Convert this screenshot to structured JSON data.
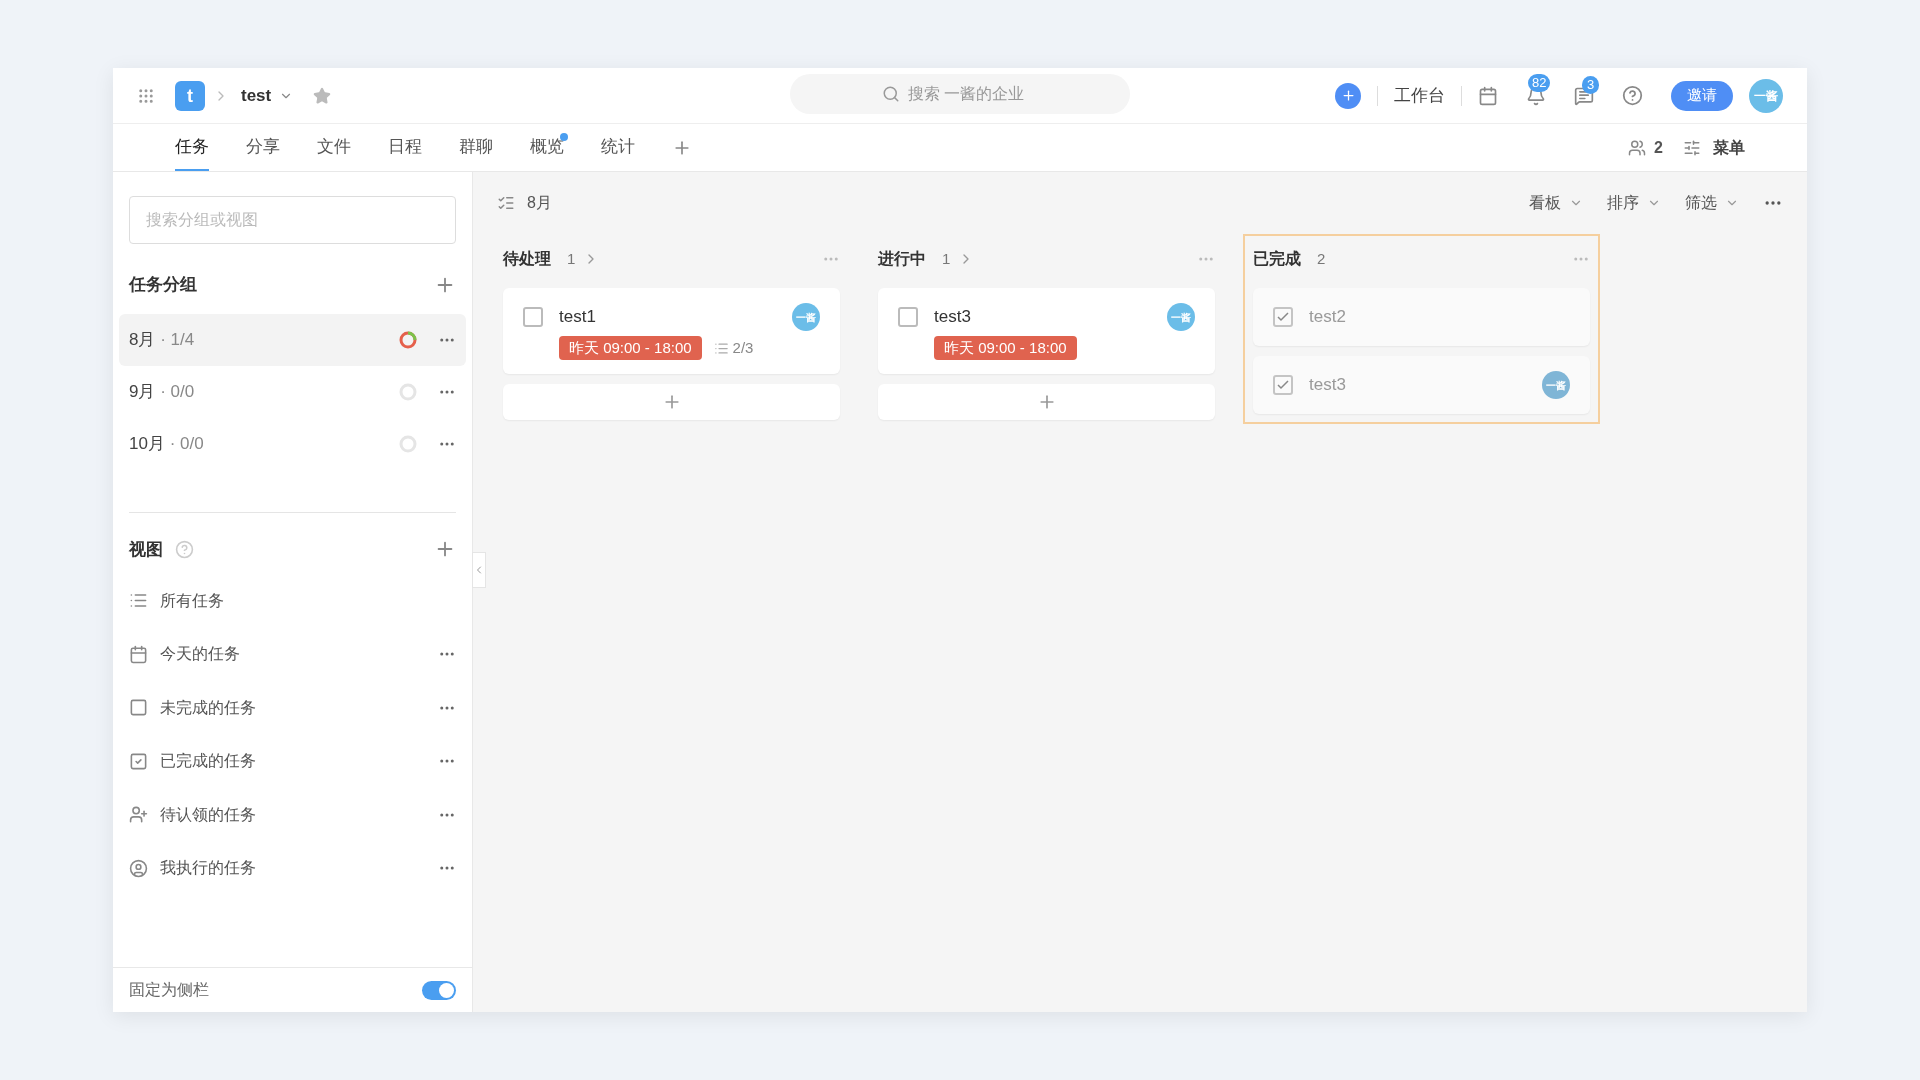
{
  "topbar": {
    "app_letter": "t",
    "project": "test",
    "starred": false,
    "search": {
      "placeholder": "搜索 一酱的企业"
    },
    "workbench": "工作台",
    "notifications": "82",
    "messages": "3",
    "invite": "邀请",
    "avatar": "一酱"
  },
  "tabs": [
    {
      "label": "任务",
      "selected": true,
      "dot": false
    },
    {
      "label": "分享",
      "selected": false,
      "dot": false
    },
    {
      "label": "文件",
      "selected": false,
      "dot": false
    },
    {
      "label": "日程",
      "selected": false,
      "dot": false
    },
    {
      "label": "群聊",
      "selected": false,
      "dot": false
    },
    {
      "label": "概览",
      "selected": false,
      "dot": true
    },
    {
      "label": "统计",
      "selected": false,
      "dot": false
    }
  ],
  "members": "2",
  "menu": "菜单",
  "sidebar": {
    "search": {
      "placeholder": "搜索分组或视图"
    },
    "groups_title": "任务分组",
    "groups": [
      {
        "name": "8月",
        "count": "· 1/4",
        "selected": true,
        "level": 0.25
      },
      {
        "name": "9月",
        "count": "· 0/0",
        "selected": false,
        "level": 0
      },
      {
        "name": "10月",
        "count": "· 0/0",
        "selected": false,
        "level": 0
      }
    ],
    "views_title": "视图",
    "views": [
      {
        "kind": "list",
        "label": "所有任务",
        "has_menu": false
      },
      {
        "kind": "calendar",
        "label": "今天的任务",
        "has_menu": true
      },
      {
        "kind": "open",
        "label": "未完成的任务",
        "has_menu": true
      },
      {
        "kind": "done",
        "label": "已完成的任务",
        "has_menu": true
      },
      {
        "kind": "claim",
        "label": "待认领的任务",
        "has_menu": true
      },
      {
        "kind": "mine",
        "label": "我执行的任务",
        "has_menu": true
      }
    ],
    "pin": {
      "label": "固定为侧栏",
      "on": true
    }
  },
  "board": {
    "title": "8月",
    "controls": [
      "看板",
      "排序",
      "筛选"
    ],
    "columns": [
      {
        "title": "待处理",
        "count": "1",
        "highlighted": false,
        "cards": [
          {
            "title": "test1",
            "checked": false,
            "avatar": "一酱",
            "date": "昨天 09:00 - 18:00",
            "subtasks": "2/3"
          }
        ]
      },
      {
        "title": "进行中",
        "count": "1",
        "highlighted": false,
        "cards": [
          {
            "title": "test3",
            "checked": false,
            "avatar": "一酱",
            "date": "昨天 09:00 - 18:00"
          }
        ]
      },
      {
        "title": "已完成",
        "count": "2",
        "highlighted": true,
        "cards": [
          {
            "title": "test2",
            "checked": true
          },
          {
            "title": "test3",
            "checked": true,
            "avatar": "一酱"
          }
        ]
      }
    ]
  }
}
